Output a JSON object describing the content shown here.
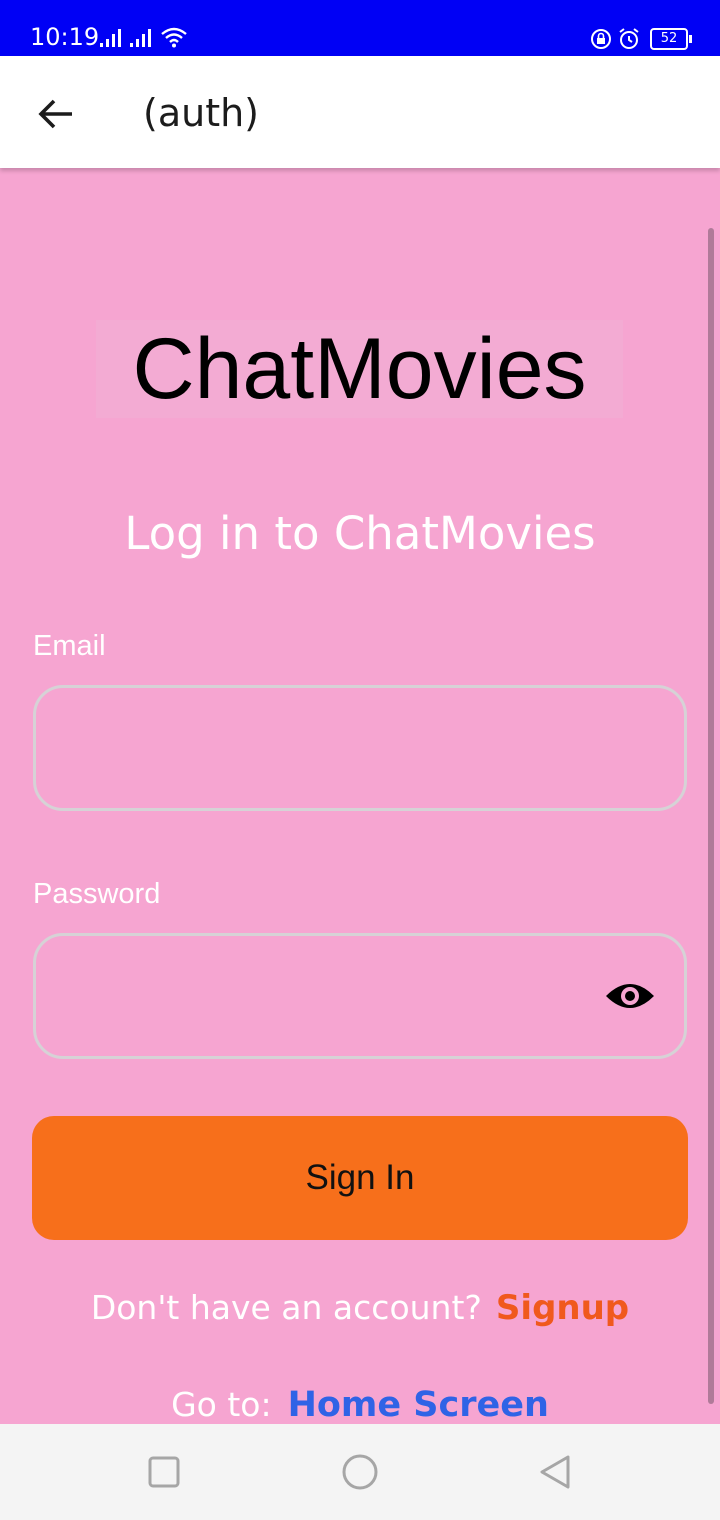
{
  "status_bar": {
    "time": "10:19",
    "battery": "52",
    "color": "#0000f5"
  },
  "app_bar": {
    "title": "(auth)",
    "back_icon": "arrow-left-icon"
  },
  "logo": {
    "text": "ChatMovies"
  },
  "heading": "Log in to ChatMovies",
  "form": {
    "email_label": "Email",
    "email_value": "",
    "password_label": "Password",
    "password_value": "",
    "password_toggle_icon": "eye-icon",
    "submit_label": "Sign In"
  },
  "signup_prompt": {
    "text": "Don't have an account?",
    "link": "Signup"
  },
  "goto_prompt": {
    "text": "Go to:",
    "link": "Home Screen"
  },
  "colors": {
    "background": "#f6a5d1",
    "button": "#f76f1b",
    "signup_link": "#f0591d",
    "home_link": "#2f63e6"
  },
  "nav_bar": {
    "icons": [
      "recents-square-icon",
      "home-circle-icon",
      "back-triangle-icon"
    ]
  }
}
